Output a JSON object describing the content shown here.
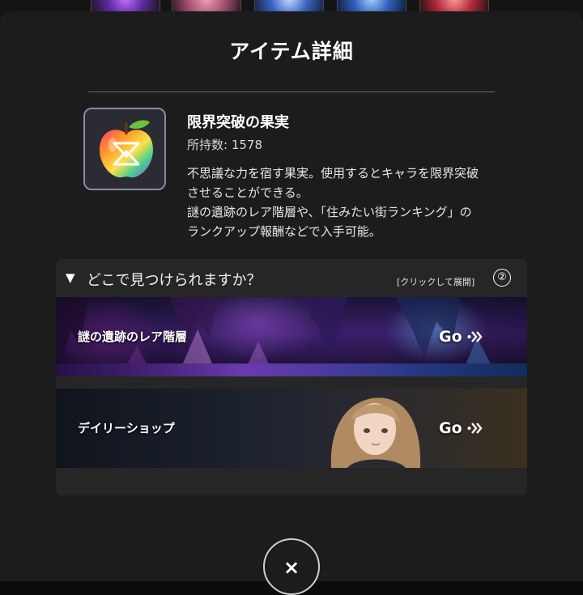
{
  "modal": {
    "title": "アイテム詳細"
  },
  "item": {
    "name": "限界突破の果実",
    "count_label": "所持数: ",
    "count_value": "1578",
    "description_lines": [
      "不思議な力を宿す果実。使用するとキャラを限界突破",
      "させることができる。",
      "謎の遺跡のレア階層や、「住みたい街ランキング」の",
      "ランクアップ報酬などで入手可能。"
    ],
    "icon": "rainbow-apple-icon"
  },
  "where_panel": {
    "caret": "▼",
    "title": "どこで見つけられますか？",
    "expand_hint": "[クリックして展開]",
    "help": "②",
    "locations": [
      {
        "label": "謎の遺跡のレア階層",
        "go": "Go"
      },
      {
        "label": "デイリーショップ",
        "go": "Go"
      }
    ]
  },
  "close_button": {
    "label": "×"
  },
  "colors": {
    "modal_bg": "#1c1c1c",
    "panel_bg": "#262626",
    "text": "#ffffff"
  }
}
